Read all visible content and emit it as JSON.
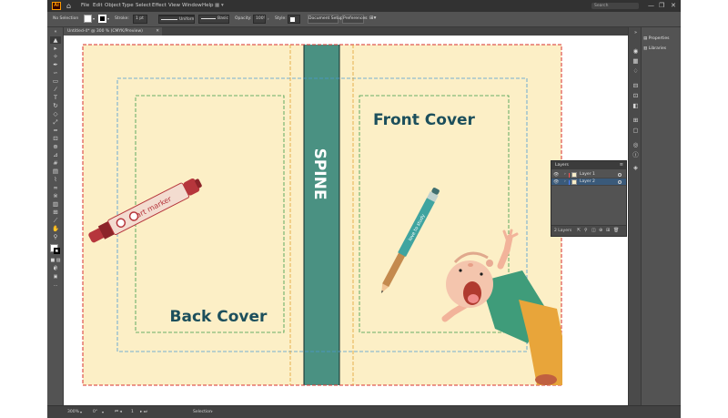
{
  "app": {
    "logo": "Ai",
    "home_icon": "⌂"
  },
  "menu": [
    "File",
    "Edit",
    "Object",
    "Type",
    "Select",
    "Effect",
    "View",
    "Window",
    "Help"
  ],
  "search": {
    "placeholder": "Search"
  },
  "window_controls": {
    "minimize": "—",
    "restore": "❐",
    "close": "✕"
  },
  "control_bar": {
    "selection": "No Selection",
    "stroke_label": "Stroke:",
    "stroke_value": "1 pt",
    "brush": "Uniform",
    "style_preset": "Basic",
    "opacity_label": "Opacity:",
    "opacity_value": "100%",
    "style_label": "Style:",
    "document_setup": "Document Setup",
    "preferences": "Preferences",
    "fill_color": "#ffffff",
    "stroke_color": "#000000"
  },
  "document": {
    "tab": "Untitled-4* @ 300 % (CMYK/Preview)"
  },
  "artboard": {
    "spine": "SPINE",
    "front_cover": "Front Cover",
    "back_cover": "Back Cover",
    "marker_label": "art marker",
    "pencil_label": "love to study",
    "bg_color": "#fcefc6",
    "spine_color": "#4a9182",
    "title_color": "#1c4f5c"
  },
  "right_panel": {
    "properties": "Properties",
    "libraries": "Libraries"
  },
  "layers_panel": {
    "title": "Layers",
    "layers": [
      {
        "name": "Layer 1",
        "color": "#ff4f4f"
      },
      {
        "name": "Layer 2",
        "color": "#4f7fff"
      }
    ],
    "count": "2 Layers"
  },
  "status": {
    "zoom": "300%",
    "angle": "0°",
    "artboard": "1",
    "tool": "Selection"
  }
}
